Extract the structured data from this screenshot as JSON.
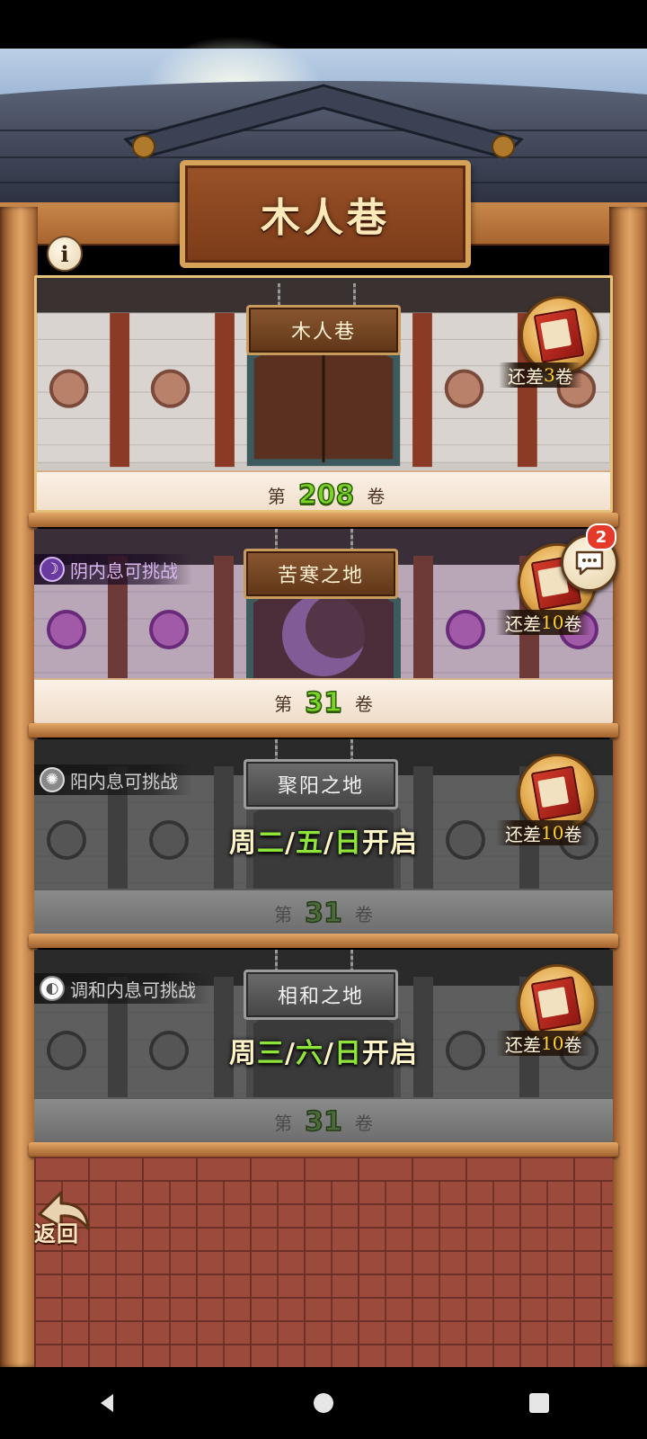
{
  "header": {
    "title": "木人巷",
    "info_icon": "info-icon"
  },
  "panels": [
    {
      "sign": "木人巷",
      "floor_prefix": "第",
      "floor_number": "208",
      "floor_suffix": "卷",
      "remaining_prefix": "还差",
      "remaining_count": "3",
      "remaining_suffix": "卷",
      "state": "active"
    },
    {
      "tag": "阴内息可挑战",
      "sign": "苦寒之地",
      "floor_prefix": "第",
      "floor_number": "31",
      "floor_suffix": "卷",
      "remaining_prefix": "还差",
      "remaining_count": "10",
      "remaining_suffix": "卷",
      "state": "available"
    },
    {
      "tag": "阳内息可挑战",
      "sign": "聚阳之地",
      "schedule": {
        "prefix": "周",
        "days": [
          "二",
          "五",
          "日"
        ],
        "sep": "/",
        "suffix": "开启"
      },
      "floor_prefix": "第",
      "floor_number": "31",
      "floor_suffix": "卷",
      "remaining_prefix": "还差",
      "remaining_count": "10",
      "remaining_suffix": "卷",
      "state": "locked"
    },
    {
      "tag": "调和内息可挑战",
      "sign": "相和之地",
      "schedule": {
        "prefix": "周",
        "days": [
          "三",
          "六",
          "日"
        ],
        "sep": "/",
        "suffix": "开启"
      },
      "floor_prefix": "第",
      "floor_number": "31",
      "floor_suffix": "卷",
      "remaining_prefix": "还差",
      "remaining_count": "10",
      "remaining_suffix": "卷",
      "state": "locked"
    }
  ],
  "chat": {
    "badge_count": "2",
    "icon": "chat-icon"
  },
  "back": {
    "label": "返回",
    "icon": "back-arrow-icon"
  },
  "nav": {
    "back": "nav-back-icon",
    "home": "nav-home-icon",
    "recents": "nav-recents-icon"
  },
  "colors": {
    "floor_number": "#7bd326",
    "remaining_number": "#ffd02a",
    "day_highlight": "#8fe43a"
  }
}
